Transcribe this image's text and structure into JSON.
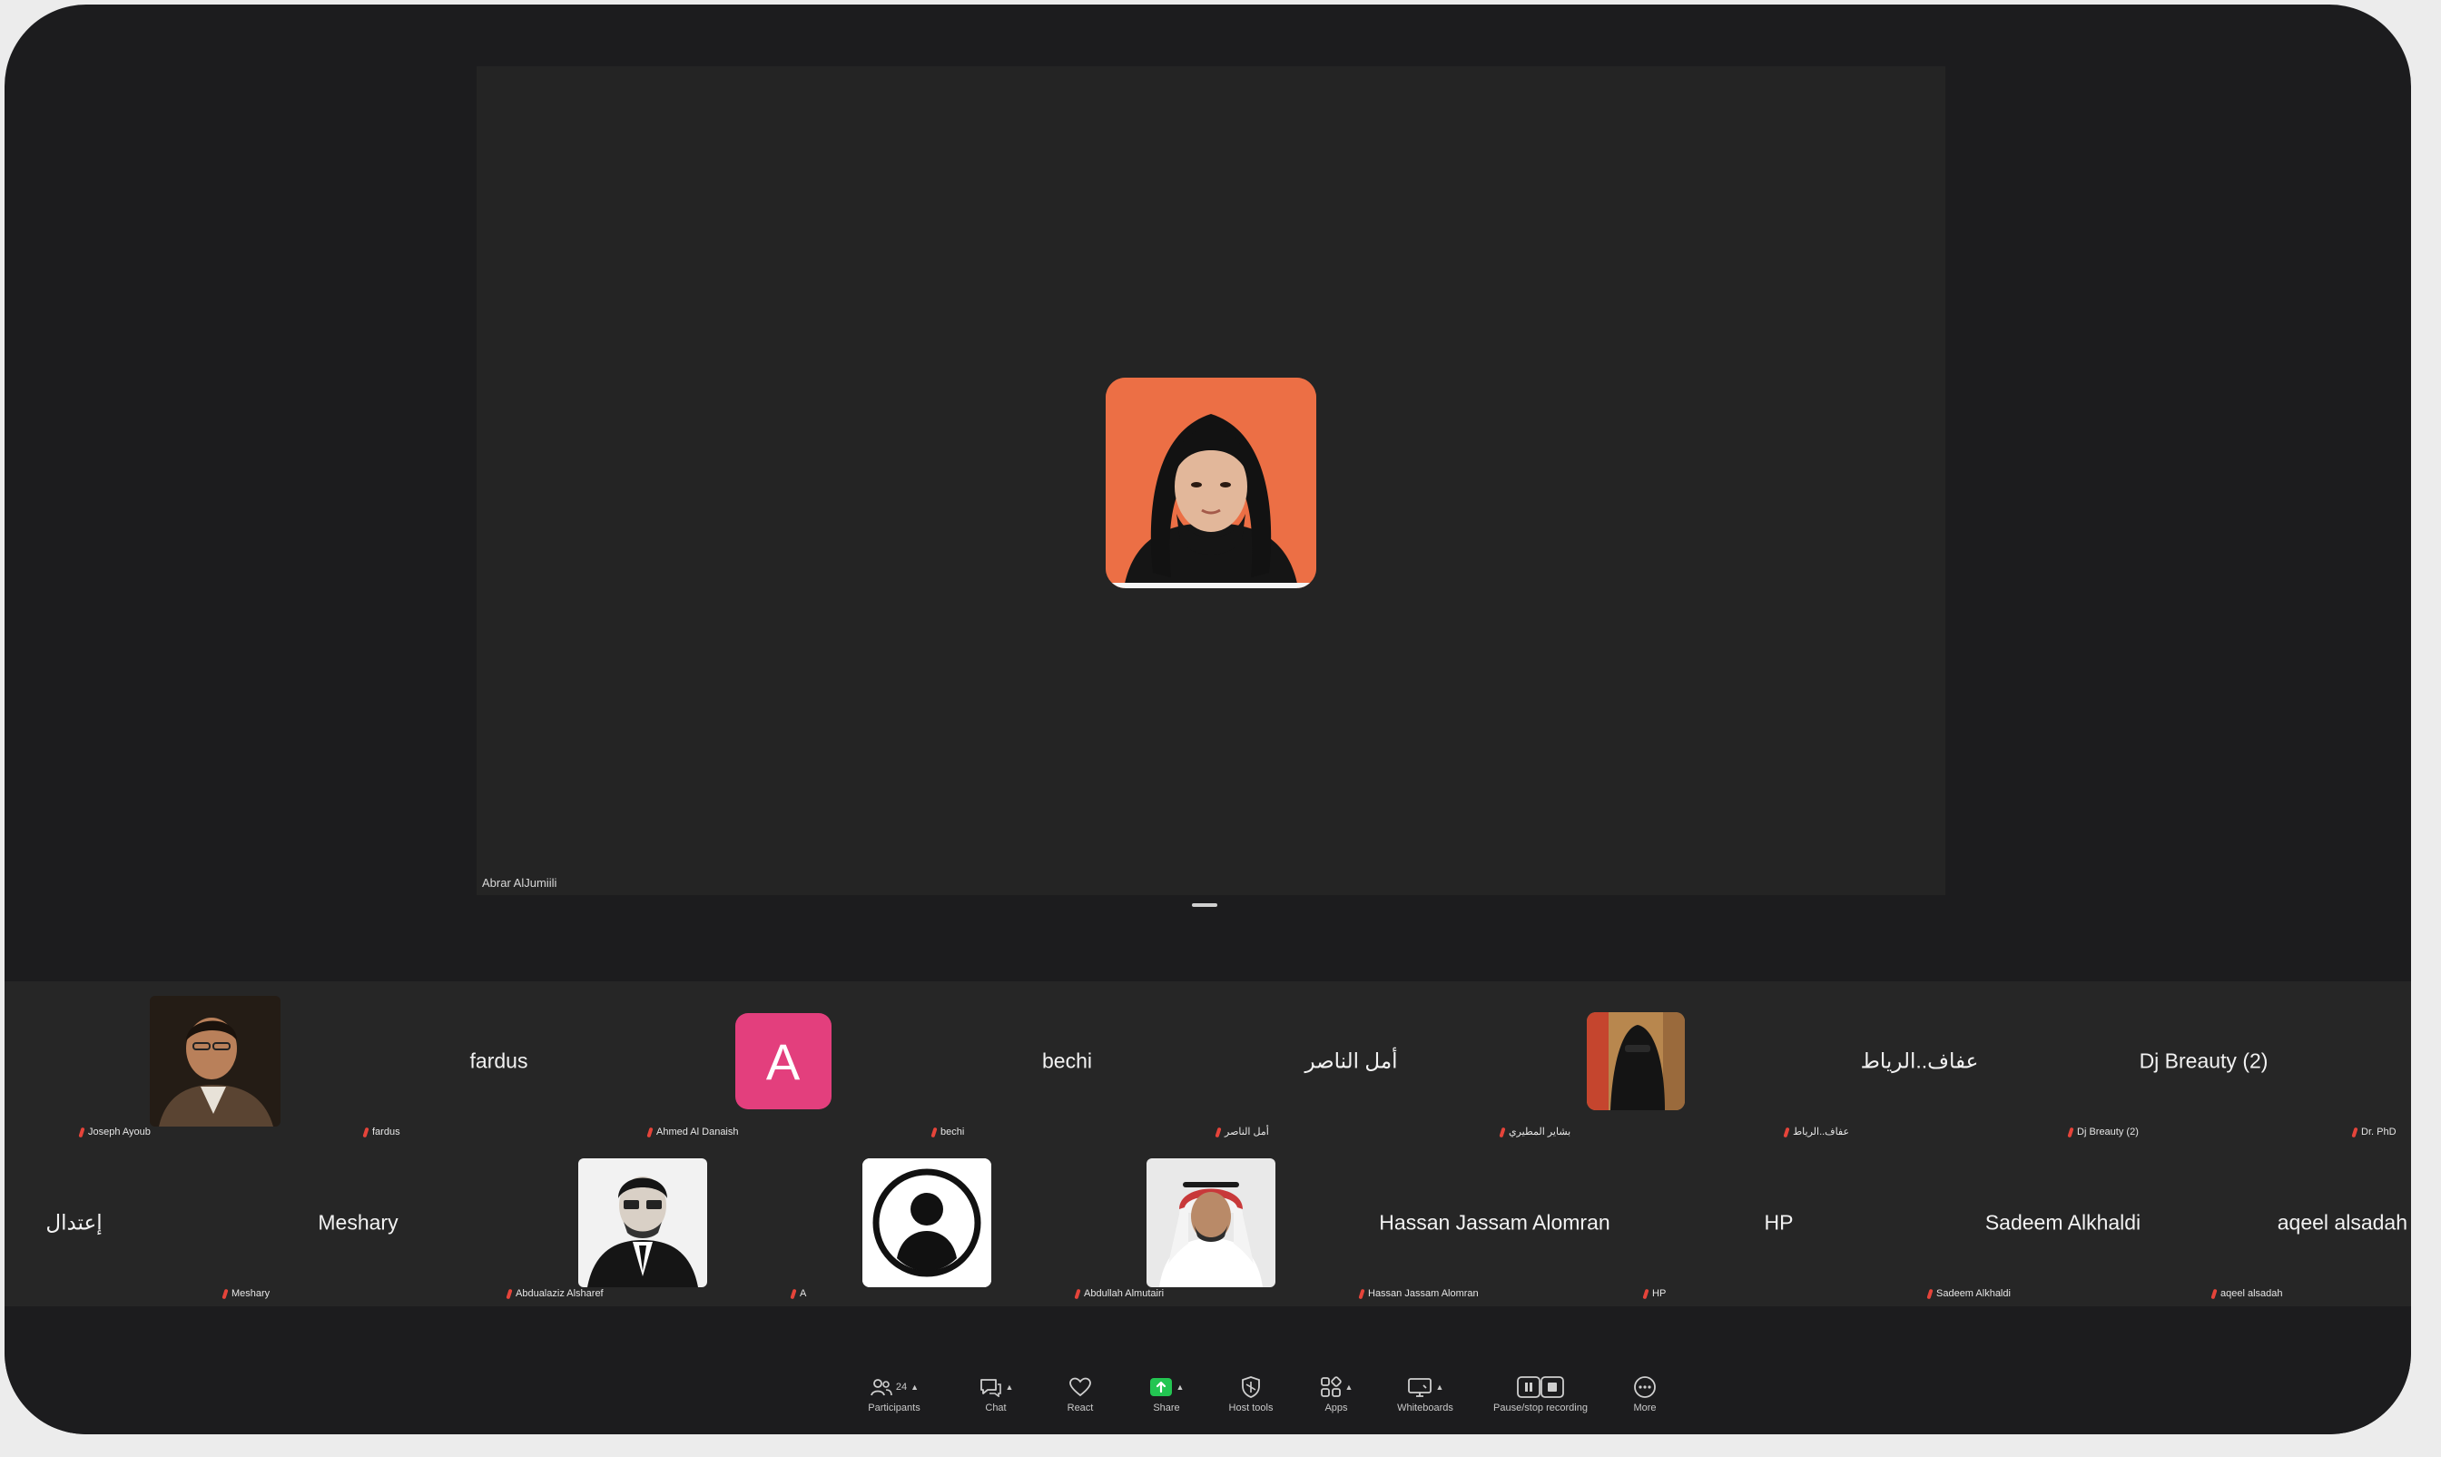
{
  "meeting": {
    "active_speaker": {
      "name": "Abrar AlJumiili"
    }
  },
  "gallery": {
    "row1": [
      {
        "center_name": "",
        "label": "Joseph Ayoub",
        "avatar": "photo-man-with-glasses"
      },
      {
        "center_name": "fardus",
        "label": "fardus",
        "avatar": ""
      },
      {
        "center_name": "",
        "label": "Ahmed Al Danaish",
        "avatar": "letter-A"
      },
      {
        "center_name": "bechi",
        "label": "bechi",
        "avatar": ""
      },
      {
        "center_name": "أمل الناصر",
        "label": "أمل الناصر",
        "avatar": ""
      },
      {
        "center_name": "",
        "label": "بشاير المطيري",
        "avatar": "photo-veiled-person"
      },
      {
        "center_name": "عفاف..الرياط",
        "label": "عفاف..الرياط",
        "avatar": ""
      },
      {
        "center_name": "Dj Breauty (2)",
        "label": "Dj Breauty (2)",
        "avatar": ""
      },
      {
        "center_name": "",
        "label": "Dr. PhD",
        "avatar": ""
      }
    ],
    "row2": [
      {
        "center_name": "إعتدال",
        "label": "",
        "avatar": ""
      },
      {
        "center_name": "Meshary",
        "label": "Meshary",
        "avatar": ""
      },
      {
        "center_name": "",
        "label": "Abdualaziz Alsharef",
        "avatar": "photo-man-in-suit"
      },
      {
        "center_name": "",
        "label": "A",
        "avatar": "generic-person-icon"
      },
      {
        "center_name": "",
        "label": "Abdullah Almutairi",
        "avatar": "photo-man-in-thobe"
      },
      {
        "center_name": "Hassan Jassam Alomran",
        "label": "Hassan Jassam Alomran",
        "avatar": ""
      },
      {
        "center_name": "HP",
        "label": "HP",
        "avatar": ""
      },
      {
        "center_name": "Sadeem Alkhaldi",
        "label": "Sadeem Alkhaldi",
        "avatar": ""
      },
      {
        "center_name": "aqeel alsadah",
        "label": "aqeel alsadah",
        "avatar": ""
      }
    ]
  },
  "toolbar": {
    "participants": {
      "label": "Participants",
      "count": "24",
      "icon": "participants-icon"
    },
    "chat": {
      "label": "Chat",
      "icon": "chat-icon"
    },
    "react": {
      "label": "React",
      "icon": "heart-icon"
    },
    "share": {
      "label": "Share",
      "icon": "share-icon",
      "color": "#23c552"
    },
    "host_tools": {
      "label": "Host tools",
      "icon": "shield-icon"
    },
    "apps": {
      "label": "Apps",
      "icon": "apps-icon"
    },
    "whiteboards": {
      "label": "Whiteboards",
      "icon": "whiteboard-icon"
    },
    "recording": {
      "label": "Pause/stop recording",
      "icon": "record-controls-icon"
    },
    "more": {
      "label": "More",
      "icon": "more-icon"
    }
  },
  "colors": {
    "frame": "#1c1c1e",
    "stage": "#242424",
    "strip": "#262626",
    "speaker_avatar_bg": "#ec6f45",
    "letter_avatar_bg": "#e33f7d",
    "mic_muted": "#e5443a"
  }
}
